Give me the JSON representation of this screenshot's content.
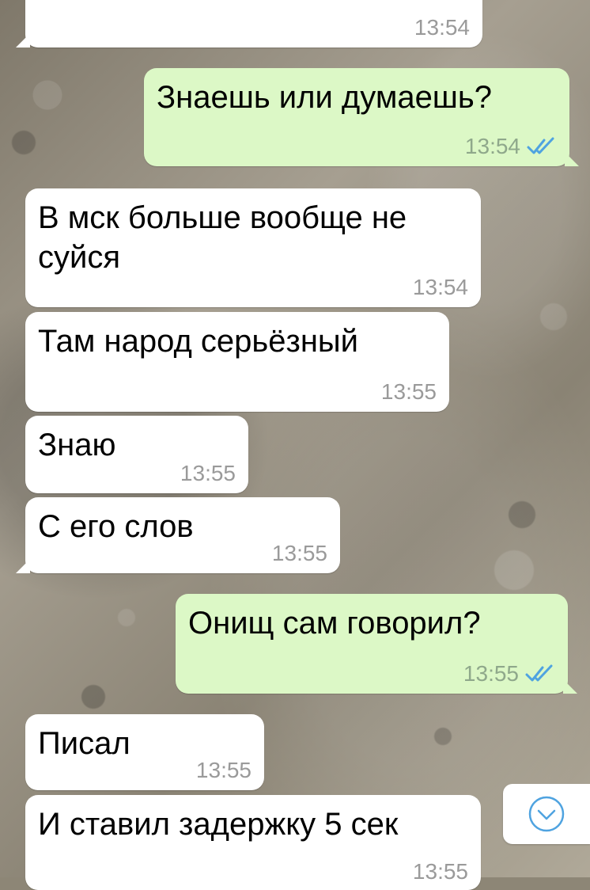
{
  "chat": {
    "messages": [
      {
        "direction": "in",
        "text": "",
        "time": "13:54"
      },
      {
        "direction": "out",
        "text": "Знаешь или думаешь?",
        "time": "13:54",
        "status": "read"
      },
      {
        "direction": "in",
        "text": "В мск больше вообще не суйся",
        "time": "13:54"
      },
      {
        "direction": "in",
        "text": "Там народ серьёзный",
        "time": "13:55"
      },
      {
        "direction": "in",
        "text": "Знаю",
        "time": "13:55"
      },
      {
        "direction": "in",
        "text": "С его слов",
        "time": "13:55"
      },
      {
        "direction": "out",
        "text": "Онищ сам говорил?",
        "time": "13:55",
        "status": "read"
      },
      {
        "direction": "in",
        "text": "Писал",
        "time": "13:55"
      },
      {
        "direction": "in",
        "text": "И ставил задержку 5 сек",
        "time": "13:55"
      }
    ]
  },
  "colors": {
    "incoming_bubble": "#ffffff",
    "outgoing_bubble": "#dcf8c6",
    "read_ticks": "#4fa3e0",
    "timestamp": "#9a9a9a"
  },
  "icons": {
    "read_receipt": "double-check-icon",
    "scroll_down": "chevron-down-circle-icon"
  }
}
